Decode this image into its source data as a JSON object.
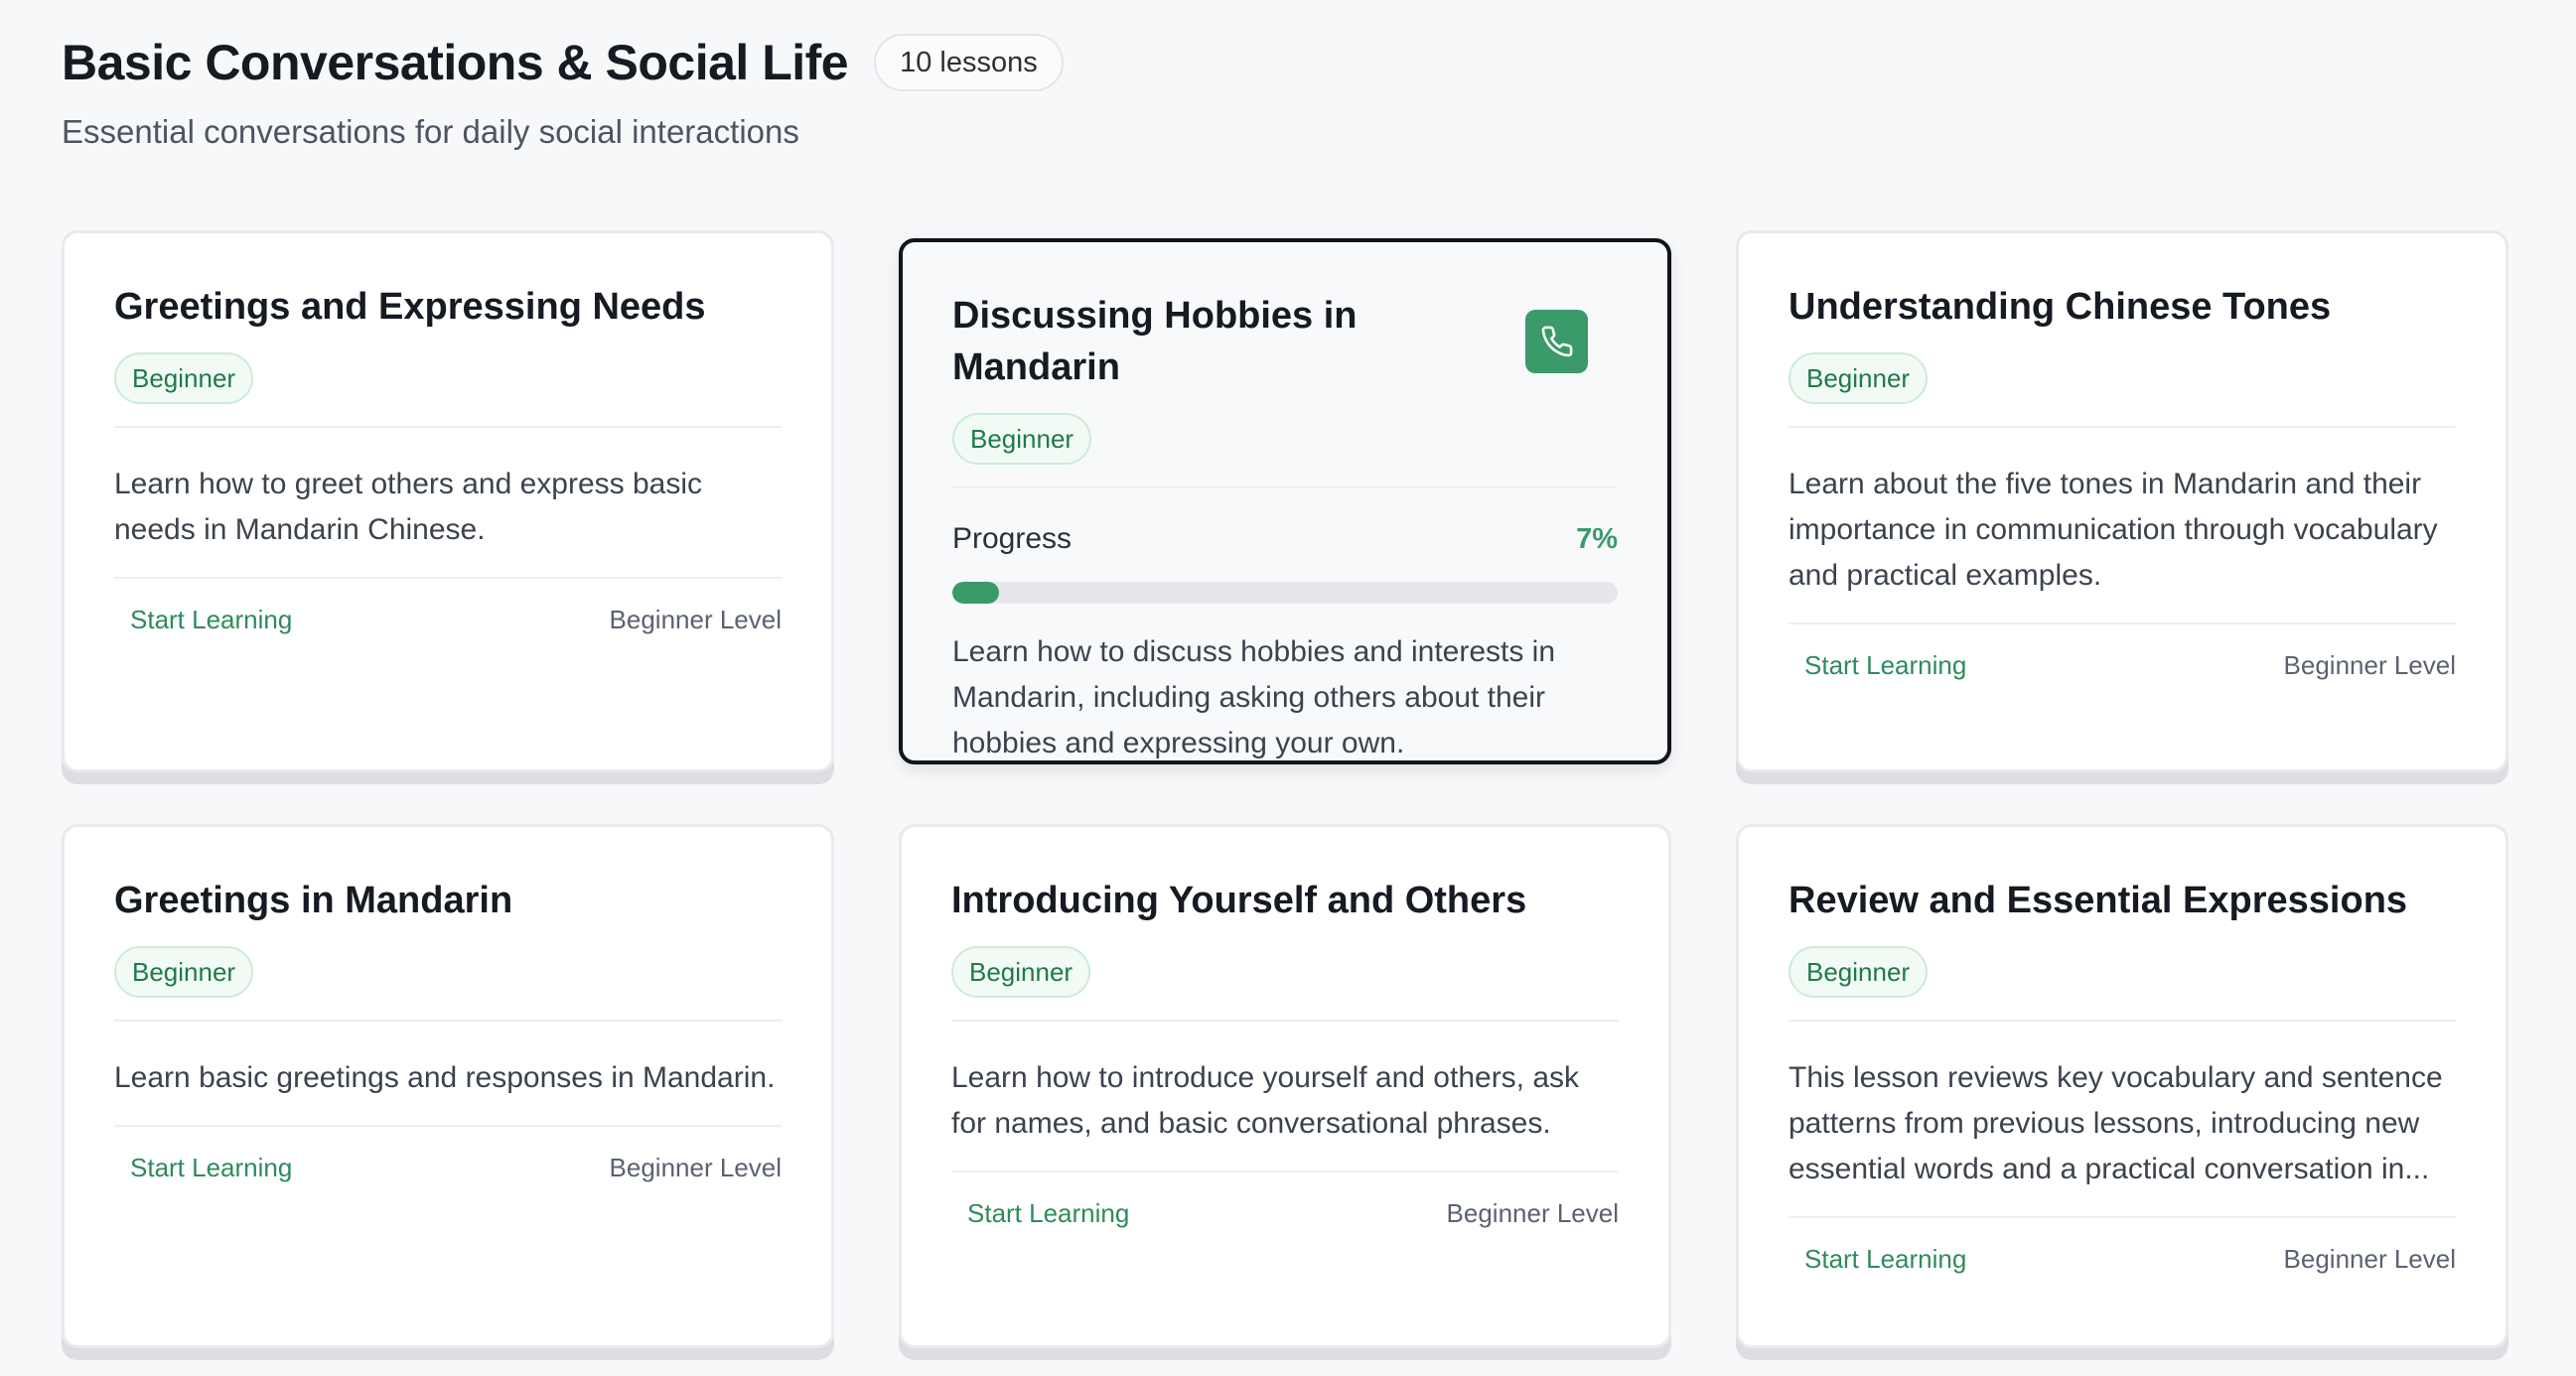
{
  "header": {
    "title": "Basic Conversations & Social Life",
    "lesson_count": "10 lessons",
    "subtitle": "Essential conversations for daily social interactions"
  },
  "colors": {
    "accent": "#3a9a6a",
    "badge_text": "#1f7a4a",
    "active_border": "#111418"
  },
  "icons": {
    "call": "phone-icon"
  },
  "lessons": [
    {
      "title": "Greetings and Expressing Needs",
      "level_badge": "Beginner",
      "description": "Learn how to greet others and express basic needs in Mandarin Chinese.",
      "start_label": "Start Learning",
      "level_text": "Beginner Level"
    },
    {
      "title": "Discussing Hobbies in Mandarin",
      "level_badge": "Beginner",
      "progress_label": "Progress",
      "progress_value": "7%",
      "progress_fraction": 0.07,
      "description": "Learn how to discuss hobbies and interests in Mandarin, including asking others about their hobbies and expressing your own."
    },
    {
      "title": "Understanding Chinese Tones",
      "level_badge": "Beginner",
      "description": "Learn about the five tones in Mandarin and their importance in communication through vocabulary and practical examples.",
      "start_label": "Start Learning",
      "level_text": "Beginner Level"
    },
    {
      "title": "Greetings in Mandarin",
      "level_badge": "Beginner",
      "description": "Learn basic greetings and responses in Mandarin.",
      "start_label": "Start Learning",
      "level_text": "Beginner Level"
    },
    {
      "title": "Introducing Yourself and Others",
      "level_badge": "Beginner",
      "description": "Learn how to introduce yourself and others, ask for names, and basic conversational phrases.",
      "start_label": "Start Learning",
      "level_text": "Beginner Level"
    },
    {
      "title": "Review and Essential Expressions",
      "level_badge": "Beginner",
      "description": "This lesson reviews key vocabulary and sentence patterns from previous lessons, introducing new essential words and a practical conversation in...",
      "start_label": "Start Learning",
      "level_text": "Beginner Level"
    }
  ]
}
